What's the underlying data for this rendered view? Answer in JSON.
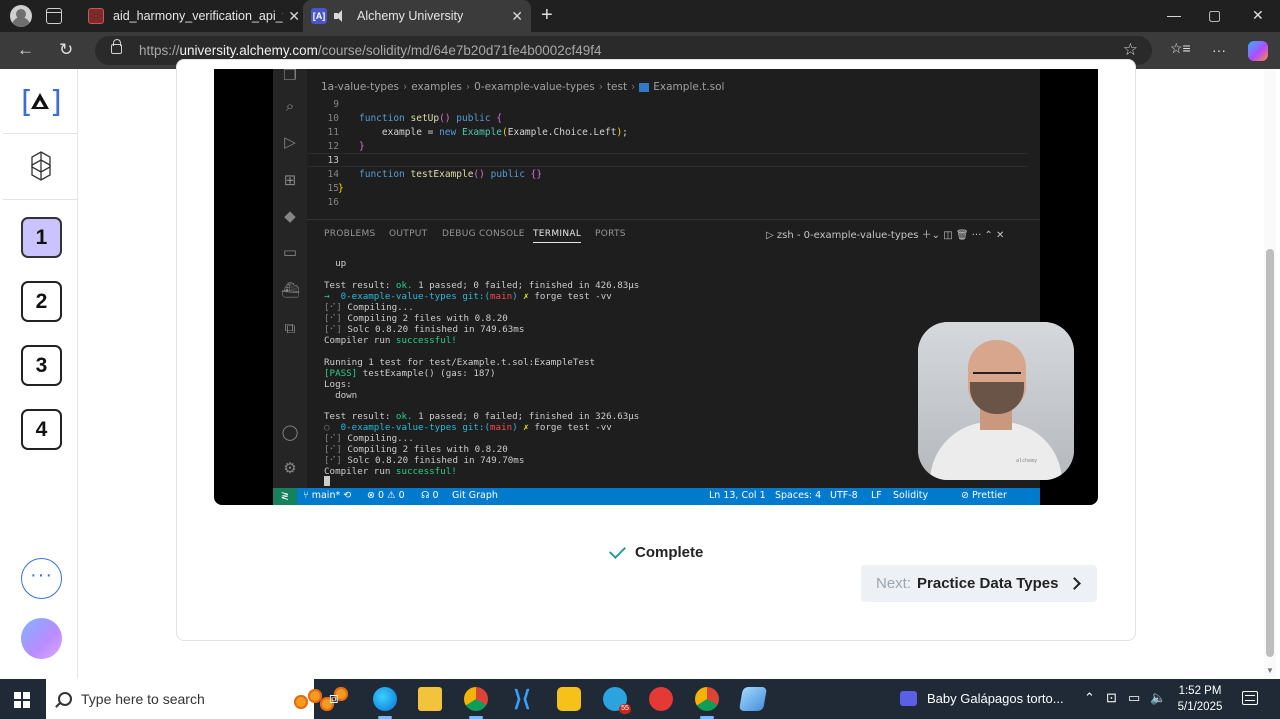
{
  "browser": {
    "tabs": [
      {
        "title": "aid_harmony_verification_api_field"
      },
      {
        "title": "Alchemy University",
        "favicon_text": "[A]"
      }
    ],
    "url_prefix": "https://",
    "url_host": "university.alchemy.com",
    "url_path": "/course/solidity/md/64e7b20d71fe4b0002cf49f4",
    "controls": {
      "minimize": "—",
      "maximize": "▢",
      "close": "✕",
      "new_tab": "+"
    },
    "nav": {
      "back": "←",
      "refresh": "↻",
      "favorite": "☆",
      "collections": "☆≡",
      "more": "···"
    }
  },
  "sidebar": {
    "lessons": [
      "1",
      "2",
      "3",
      "4"
    ],
    "active_lesson": "1",
    "more": "···"
  },
  "video": {
    "breadcrumb": [
      "1a-value-types",
      "examples",
      "0-example-value-types",
      "test",
      "Example.t.sol"
    ],
    "code_lines": [
      {
        "n": "9"
      },
      {
        "n": "10"
      },
      {
        "n": "11"
      },
      {
        "n": "12"
      },
      {
        "n": "13"
      },
      {
        "n": "14"
      },
      {
        "n": "15"
      },
      {
        "n": "16"
      }
    ],
    "panel_tabs": [
      "PROBLEMS",
      "OUTPUT",
      "DEBUG CONSOLE",
      "TERMINAL",
      "PORTS"
    ],
    "terminal_name": "zsh - 0-example-value-types",
    "terminal": {
      "l1": "up",
      "l2_a": "Test result: ",
      "l2_ok": "ok.",
      "l2_b": " 1 passed; 0 failed; finished in 426.83µs",
      "prompt_dir": "0-example-value-types",
      "prompt_git": "git:(",
      "prompt_branch": "main",
      "prompt_close": ")",
      "prompt_x": "✗",
      "prompt_cmd": "forge test -vv",
      "compiling": "Compiling...",
      "compiling2": "Compiling 2 files with 0.8.20",
      "solc1": "Solc 0.8.20 finished in 749.63ms",
      "compiler_a": "Compiler run ",
      "compiler_ok": "successful!",
      "running": "Running 1 test for test/Example.t.sol:ExampleTest",
      "pass_tag": "[PASS]",
      "pass_rest": " testExample() (gas: 187)",
      "logs": "Logs:",
      "down": "  down",
      "l3_b": " 1 passed; 0 failed; finished in 326.63µs",
      "solc2": "Solc 0.8.20 finished in 749.70ms",
      "bracket": "[⠊]"
    },
    "status": {
      "branch": "main*",
      "problems": "⊗ 0 ⚠ 0",
      "ports": "☊ 0",
      "git_graph": "Git Graph",
      "position": "Ln 13, Col 1",
      "spaces": "Spaces: 4",
      "encoding": "UTF-8",
      "eol": "LF",
      "language": "Solidity",
      "prettier": "Prettier"
    },
    "webcam_tag": "alchemy"
  },
  "lesson": {
    "complete_label": "Complete",
    "next_prefix": "Next:",
    "next_title": "Practice Data Types"
  },
  "taskbar": {
    "search_placeholder": "Type here to search",
    "telegram_badge": "55",
    "media_title": "Baby Galápagos torto...",
    "time": "1:52 PM",
    "date": "5/1/2025"
  },
  "colors": {
    "accent": "#3d6bd6",
    "active_lesson": "#cbc3ff",
    "vscode_status": "#007acc",
    "complete_check": "#2a9d8f"
  }
}
